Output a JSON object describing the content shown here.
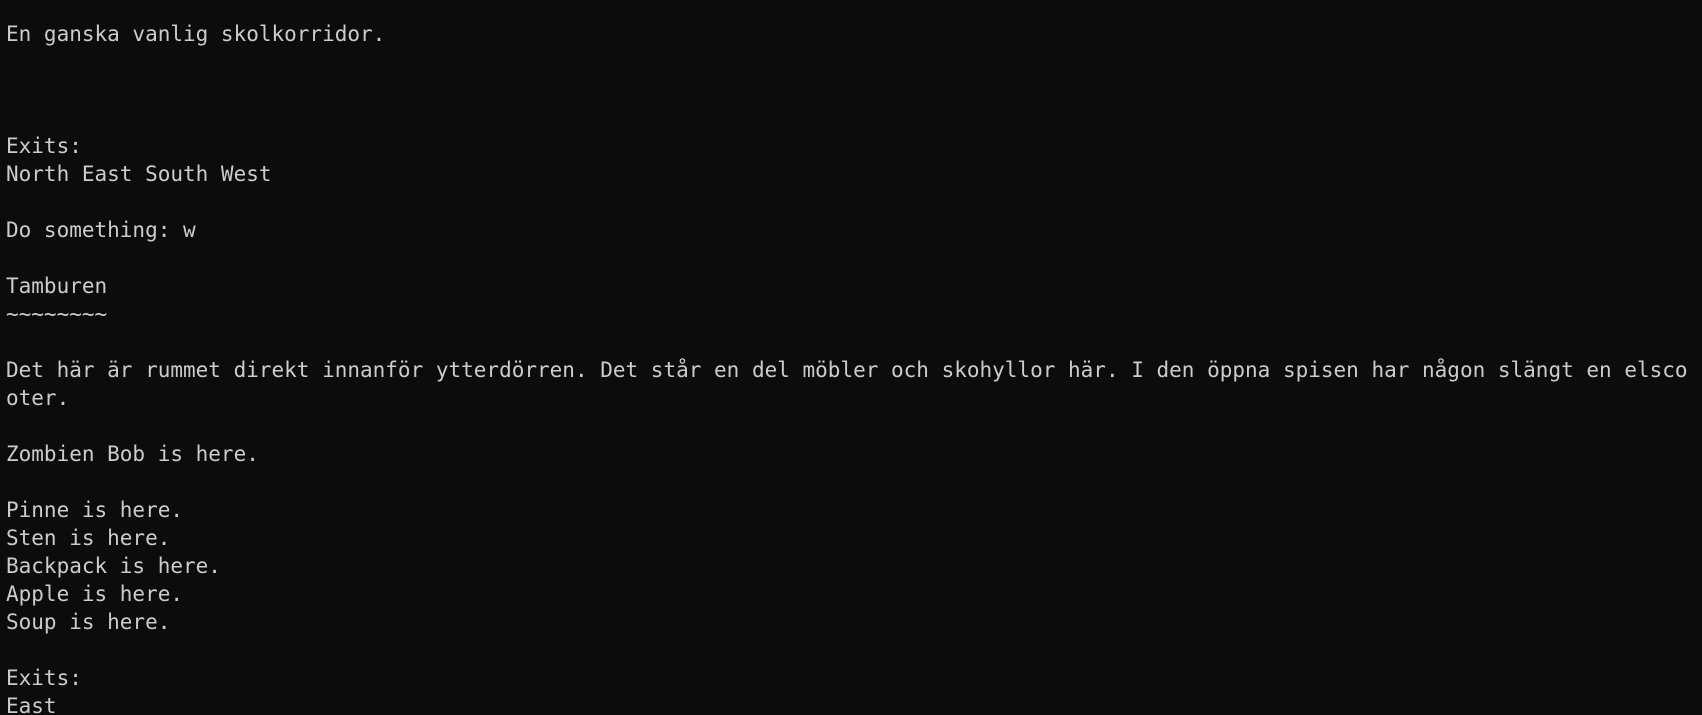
{
  "terminal": {
    "previous_room_description": "En ganska vanlig skolkorridor.",
    "previous_exits_heading": "Exits:",
    "previous_exits": "North East South West",
    "prompt": "Do something: w",
    "room_title": "Tamburen",
    "room_title_underline": "~~~~~~~~",
    "room_description": "Det här är rummet direkt innanför ytterdörren. Det står en del möbler och skohyllor här. I den öppna spisen har någon slängt en elscooter.",
    "npc_lines": [
      "Zombien Bob is here."
    ],
    "item_lines": [
      "Pinne is here.",
      "Sten is here.",
      "Backpack is here.",
      "Apple is here.",
      "Soup is here."
    ],
    "exits_heading": "Exits:",
    "exits": "East"
  }
}
